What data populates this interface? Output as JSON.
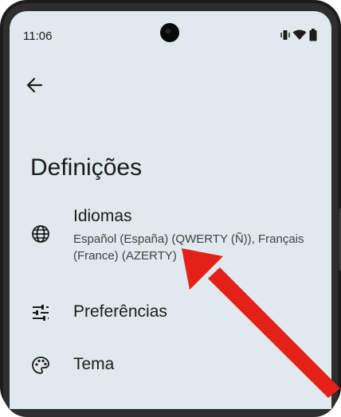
{
  "status_bar": {
    "time": "11:06",
    "icons": [
      "vibrate-icon",
      "wifi-icon",
      "battery-icon"
    ]
  },
  "header": {
    "title": "Definições",
    "back_icon": "arrow-back-icon"
  },
  "settings": {
    "items": [
      {
        "label": "Idiomas",
        "summary": "Español (España) (QWERTY (Ñ)), Français (France) (AZERTY)",
        "icon": "globe-icon"
      },
      {
        "label": "Preferências",
        "icon": "tune-icon"
      },
      {
        "label": "Tema",
        "icon": "palette-icon"
      }
    ]
  },
  "annotation": {
    "arrow_color": "#e32119"
  },
  "colors": {
    "screen_bg": "#dfe9ee",
    "text": "#1b1b1b",
    "frame": "#1c1c1c"
  }
}
